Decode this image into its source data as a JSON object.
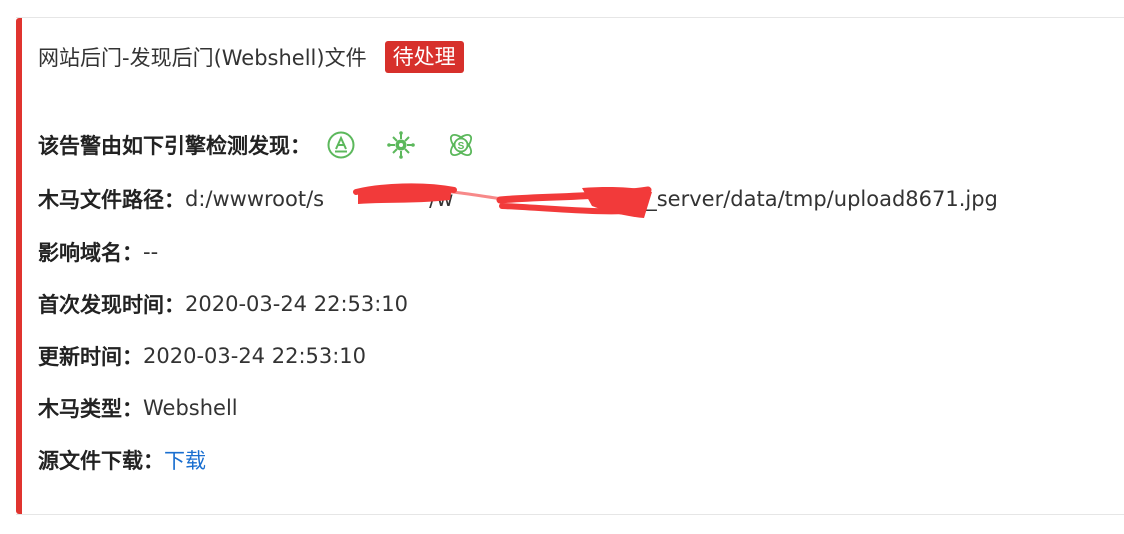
{
  "alert": {
    "title": "网站后门-发现后门(Webshell)文件",
    "status": "待处理"
  },
  "details": {
    "engines_label": "该告警由如下引擎检测发现：",
    "engines": [
      "engine-a-icon",
      "engine-virus-icon",
      "engine-atom-icon"
    ],
    "path_label": "木马文件路径：",
    "path_value": "d:/wwwroot/s     /w        uc_server/data/tmp/upload8671.jpg",
    "domain_label": "影响域名：",
    "domain_value": "--",
    "first_seen_label": "首次发现时间：",
    "first_seen_value": "2020-03-24 22:53:10",
    "updated_label": "更新时间：",
    "updated_value": "2020-03-24 22:53:10",
    "type_label": "木马类型：",
    "type_value": "Webshell",
    "download_label": "源文件下载：",
    "download_link": "下载"
  },
  "colors": {
    "accent": "#e0342f",
    "badge": "#d7302b",
    "link": "#1a6fd0",
    "engine_icon": "#5cb85c",
    "redaction": "#f23a3a"
  }
}
